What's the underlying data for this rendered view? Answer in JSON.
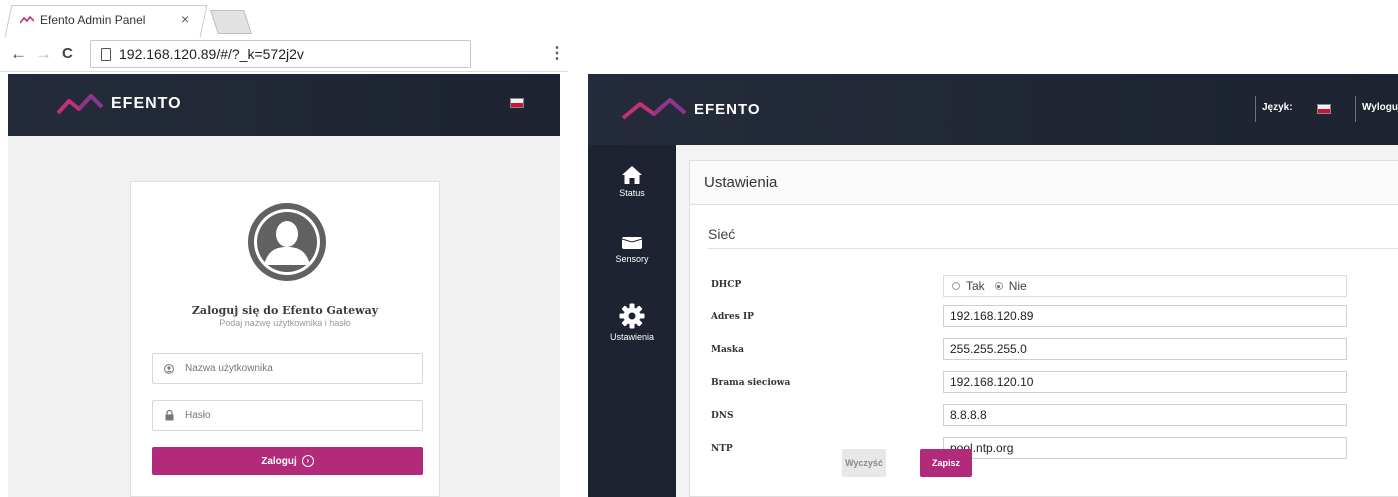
{
  "browser": {
    "tab_title": "Efento Admin Panel",
    "tab_close": "×",
    "url": "192.168.120.89/#/?_k=572j2v",
    "back": "←",
    "forward": "→",
    "reload": "C",
    "menu": "⋮"
  },
  "login": {
    "brand": "EFENTO",
    "title": "Zaloguj się do Efento Gateway",
    "subtitle": "Podaj nazwę użytkownika i hasło",
    "username_placeholder": "Nazwa użytkownika",
    "password_placeholder": "Hasło",
    "submit_label": "Zaloguj",
    "submit_icon": "›"
  },
  "admin": {
    "brand": "EFENTO",
    "language_label": "Język:",
    "logout_label": "Wyloguj",
    "sidebar": [
      {
        "label": "Status",
        "icon": "home-icon"
      },
      {
        "label": "Sensory",
        "icon": "sensor-icon"
      },
      {
        "label": "Ustawienia",
        "icon": "gear-icon"
      }
    ],
    "page_title": "Ustawienia",
    "section_title": "Sieć",
    "fields": {
      "dhcp_label": "DHCP",
      "dhcp_yes": "Tak",
      "dhcp_no": "Nie",
      "dhcp_selected": "Nie",
      "ip_label": "Adres IP",
      "ip_value": "192.168.120.89",
      "mask_label": "Maska",
      "mask_value": "255.255.255.0",
      "gateway_label": "Brama sieciowa",
      "gateway_value": "192.168.120.10",
      "dns_label": "DNS",
      "dns_value": "8.8.8.8",
      "ntp_label": "NTP",
      "ntp_value": "pool.ntp.org"
    },
    "clear_label": "Wyczyść",
    "save_label": "Zapisz"
  },
  "colors": {
    "accent": "#b22b7b",
    "header": "#1d2330",
    "logo_pink": "#c2307a",
    "logo_purple": "#7a2f8a"
  }
}
